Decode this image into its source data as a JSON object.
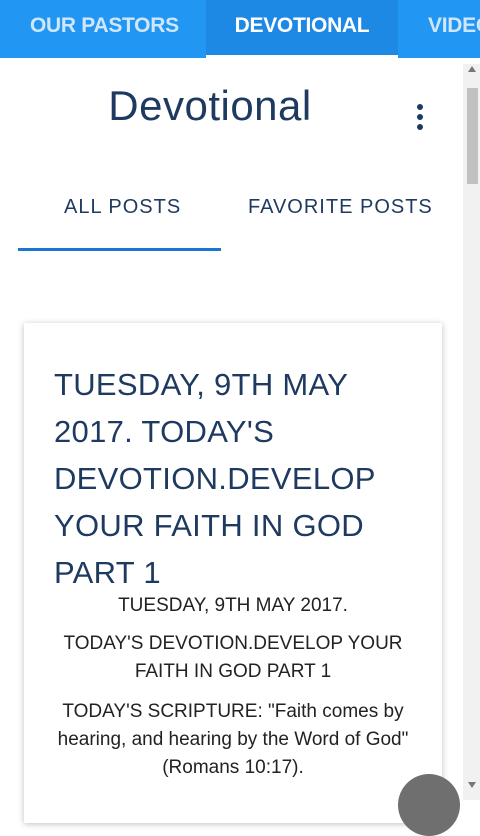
{
  "top_tabs": [
    {
      "label": "OUR PASTORS"
    },
    {
      "label": "DEVOTIONAL"
    },
    {
      "label": "VIDEOS"
    }
  ],
  "page": {
    "title": "Devotional",
    "menu_icon": "more-vert-icon"
  },
  "sub_tabs": [
    {
      "label": "ALL POSTS"
    },
    {
      "label": "FAVORITE POSTS"
    }
  ],
  "post": {
    "title": "TUESDAY, 9TH MAY 2017. TODAY'S DEVOTION.DEVELOP YOUR FAITH IN GOD PART 1",
    "paragraphs": [
      "TUESDAY, 9TH MAY 2017.",
      "TODAY'S DEVOTION.DEVELOP YOUR FAITH IN GOD PART 1",
      "TODAY'S SCRIPTURE: \"Faith comes by hearing, and hearing by the Word of God\" (Romans 10:17)."
    ]
  },
  "colors": {
    "tab_bar": "#2196f3",
    "title_text": "#1f3a60",
    "indicator": "#1976d2"
  }
}
